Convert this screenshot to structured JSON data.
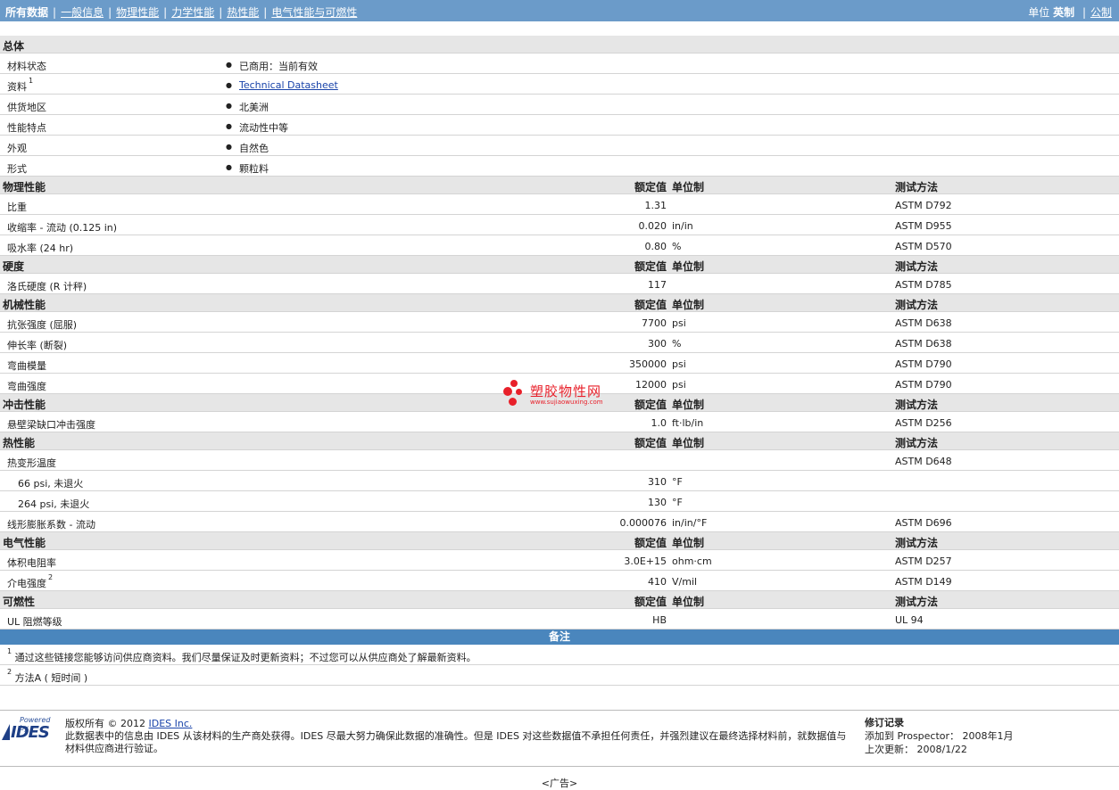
{
  "nav": {
    "current": "所有数据",
    "links": [
      "一般信息",
      "物理性能",
      "力学性能",
      "热性能",
      "电气性能与可燃性"
    ]
  },
  "units": {
    "label": "单位",
    "current": "英制",
    "alt": "公制"
  },
  "headers": {
    "nominal": "额定值",
    "unit": "单位制",
    "test": "测试方法"
  },
  "general": {
    "title": "总体",
    "rows": [
      {
        "label": "材料状态",
        "sup": "",
        "value": "已商用：当前有效",
        "link": false
      },
      {
        "label": "资料",
        "sup": "1",
        "value": "Technical Datasheet",
        "link": true
      },
      {
        "label": "供货地区",
        "sup": "",
        "value": "北美洲",
        "link": false
      },
      {
        "label": "性能特点",
        "sup": "",
        "value": "流动性中等",
        "link": false
      },
      {
        "label": "外观",
        "sup": "",
        "value": "自然色",
        "link": false
      },
      {
        "label": "形式",
        "sup": "",
        "value": "颗粒料",
        "link": false
      }
    ]
  },
  "sections": [
    {
      "title": "物理性能",
      "rows": [
        {
          "label": "比重",
          "value": "1.31",
          "unit": "",
          "test": "ASTM D792"
        },
        {
          "label": "收缩率 - 流动 (0.125 in)",
          "value": "0.020",
          "unit": "in/in",
          "test": "ASTM D955"
        },
        {
          "label": "吸水率 (24 hr)",
          "value": "0.80",
          "unit": "%",
          "test": "ASTM D570"
        }
      ]
    },
    {
      "title": "硬度",
      "rows": [
        {
          "label": "洛氏硬度 (R 计秤)",
          "value": "117",
          "unit": "",
          "test": "ASTM D785"
        }
      ]
    },
    {
      "title": "机械性能",
      "rows": [
        {
          "label": "抗张强度 (屈服)",
          "value": "7700",
          "unit": "psi",
          "test": "ASTM D638"
        },
        {
          "label": "伸长率 (断裂)",
          "value": "300",
          "unit": "%",
          "test": "ASTM D638"
        },
        {
          "label": "弯曲模量",
          "value": "350000",
          "unit": "psi",
          "test": "ASTM D790"
        },
        {
          "label": "弯曲强度",
          "value": "12000",
          "unit": "psi",
          "test": "ASTM D790"
        }
      ]
    },
    {
      "title": "冲击性能",
      "rows": [
        {
          "label": "悬壁梁缺口冲击强度",
          "value": "1.0",
          "unit": "ft·lb/in",
          "test": "ASTM D256"
        }
      ]
    },
    {
      "title": "热性能",
      "rows": [
        {
          "label": "热变形温度",
          "value": "",
          "unit": "",
          "test": "ASTM D648"
        },
        {
          "label": "66 psi, 未退火",
          "value": "310",
          "unit": "°F",
          "test": "",
          "sub": true
        },
        {
          "label": "264 psi, 未退火",
          "value": "130",
          "unit": "°F",
          "test": "",
          "sub": true
        },
        {
          "label": "线形膨胀系数 - 流动",
          "value": "0.000076",
          "unit": "in/in/°F",
          "test": "ASTM D696"
        }
      ]
    },
    {
      "title": "电气性能",
      "rows": [
        {
          "label": "体积电阻率",
          "value": "3.0E+15",
          "unit": "ohm·cm",
          "test": "ASTM D257"
        },
        {
          "label": "介电强度",
          "sup": "2",
          "value": "410",
          "unit": "V/mil",
          "test": "ASTM D149"
        }
      ]
    },
    {
      "title": "可燃性",
      "rows": [
        {
          "label": "UL 阻燃等级",
          "value": "HB",
          "unit": "",
          "test": "UL 94"
        }
      ]
    }
  ],
  "notes": {
    "title": "备注",
    "items": [
      {
        "num": "1",
        "text": "通过这些链接您能够访问供应商资料。我们尽量保证及时更新资料；不过您可以从供应商处了解最新资料。"
      },
      {
        "num": "2",
        "text": "方法A ( 短时间 )"
      }
    ]
  },
  "footer": {
    "logo_powered": "Powered by",
    "logo_name": "IDES",
    "copyright_prefix": "版权所有 © 2012",
    "company": "IDES Inc.",
    "disclaimer": "此数据表中的信息由 IDES 从该材料的生产商处获得。IDES 尽最大努力确保此数据的准确性。但是 IDES 对这些数据值不承担任何责任，并强烈建议在最终选择材料前，就数据值与材料供应商进行验证。",
    "revision_title": "修订记录",
    "added_label": "添加到 Prospector：",
    "added_value": "2008年1月",
    "updated_label": "上次更新：",
    "updated_value": "2008/1/22"
  },
  "ad": "<广告>",
  "watermark": {
    "name": "塑胶物性网",
    "url": "www.sujiaowuxing.com"
  }
}
